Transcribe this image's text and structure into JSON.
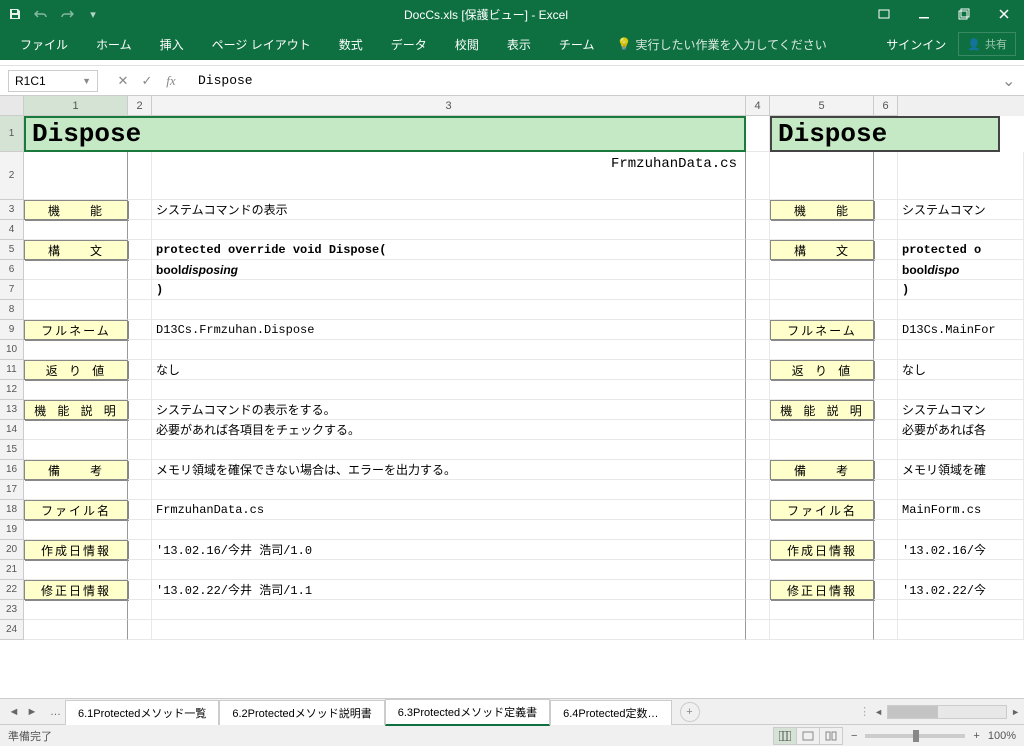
{
  "title": "DocCs.xls [保護ビュー] - Excel",
  "qat": {
    "save": "save",
    "undo": "undo",
    "redo": "redo"
  },
  "winControls": {
    "ribbonOpts": "ribbon-options",
    "min": "minimize",
    "max": "restore",
    "close": "close"
  },
  "ribbon": {
    "tabs": [
      "ファイル",
      "ホーム",
      "挿入",
      "ページ レイアウト",
      "数式",
      "データ",
      "校閲",
      "表示",
      "チーム"
    ],
    "tellme": "実行したい作業を入力してください",
    "signin": "サインイン",
    "share": "共有"
  },
  "nameBox": "R1C1",
  "formula": "Dispose",
  "cols": [
    "1",
    "2",
    "3",
    "4",
    "5",
    "6"
  ],
  "rows": {
    "r1": {
      "titleA": "Dispose",
      "titleB": "Dispose"
    },
    "r2": {
      "subA": "FrmzuhanData.cs"
    },
    "r3": {
      "labA": "機　　能",
      "valA": "システムコマンドの表示",
      "labB": "機　　能",
      "valB": "システムコマン"
    },
    "r5": {
      "labA": "構　　文",
      "valA": "protected override void Dispose(",
      "labB": "構　　文",
      "valB": "protected o"
    },
    "r6": {
      "valA_pre": "  bool ",
      "valA_it": "disposing",
      "valB_pre": "  bool ",
      "valB_it": "dispo"
    },
    "r7": {
      "valA": ")",
      "valB": ")"
    },
    "r9": {
      "labA": "フルネーム",
      "valA": "D13Cs.Frmzuhan.Dispose",
      "labB": "フルネーム",
      "valB": "D13Cs.MainFor"
    },
    "r11": {
      "labA": "返 り 値",
      "valA": "なし",
      "labB": "返 り 値",
      "valB": "なし"
    },
    "r13": {
      "labA": "機 能 説 明",
      "valA": "システムコマンドの表示をする。",
      "labB": "機 能 説 明",
      "valB": "システムコマン"
    },
    "r14": {
      "valA": "必要があれば各項目をチェックする。",
      "valB": "必要があれば各"
    },
    "r16": {
      "labA": "備　　考",
      "valA": "メモリ領域を確保できない場合は、エラーを出力する。",
      "labB": "備　　考",
      "valB": "メモリ領域を確"
    },
    "r18": {
      "labA": "ファイル名",
      "valA": "FrmzuhanData.cs",
      "labB": "ファイル名",
      "valB": "MainForm.cs"
    },
    "r20": {
      "labA": "作成日情報",
      "valA": "'13.02.16/今井 浩司/1.0",
      "labB": "作成日情報",
      "valB": "'13.02.16/今"
    },
    "r22": {
      "labA": "修正日情報",
      "valA": "'13.02.22/今井 浩司/1.1",
      "labB": "修正日情報",
      "valB": "'13.02.22/今"
    }
  },
  "sheets": {
    "tabs": [
      "6.1Protectedメソッド一覧",
      "6.2Protectedメソッド説明書",
      "6.3Protectedメソッド定義書",
      "6.4Protected定数…"
    ],
    "activeIndex": 2
  },
  "status": {
    "ready": "準備完了",
    "zoom": "100%"
  }
}
